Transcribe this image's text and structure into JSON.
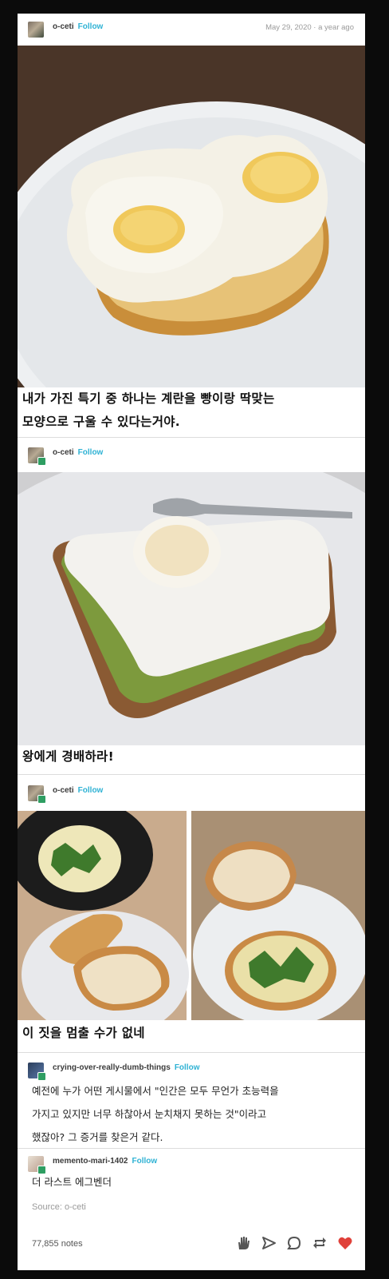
{
  "posts": [
    {
      "username": "o-ceti",
      "follow": "Follow",
      "date": "May 29, 2020 · a year ago",
      "caption_lines": [
        "내가 가진 특기 중 하나는 계란을 빵이랑 딱맞는",
        "모양으로 구울 수 있다는거야."
      ]
    },
    {
      "username": "o-ceti",
      "follow": "Follow",
      "caption_lines": [
        "왕에게 경배하라!"
      ]
    },
    {
      "username": "o-ceti",
      "follow": "Follow",
      "caption_lines": [
        "이 짓을 멈출 수가 없네"
      ]
    }
  ],
  "replies": [
    {
      "username": "crying-over-really-dumb-things",
      "follow": "Follow",
      "lines": [
        "예전에 누가 어떤 게시물에서  \"인간은 모두 무언가 초능력을",
        "가지고 있지만 너무 하찮아서 눈치채지 못하는 것\"이라고",
        "했잖아? 그 증거를 찾은거 같다."
      ]
    },
    {
      "username": "memento-mari-1402",
      "follow": "Follow",
      "lines": [
        "더 라스트 에그벤더"
      ]
    }
  ],
  "footer": {
    "source": "Source: o-ceti",
    "notes": "77,855 notes"
  },
  "icons": [
    "hand-icon",
    "share-icon",
    "comment-icon",
    "reblog-icon",
    "heart-icon"
  ],
  "colors": {
    "follow": "#2fb2d4",
    "heart": "#e0413a",
    "background": "#0b0b0b"
  }
}
